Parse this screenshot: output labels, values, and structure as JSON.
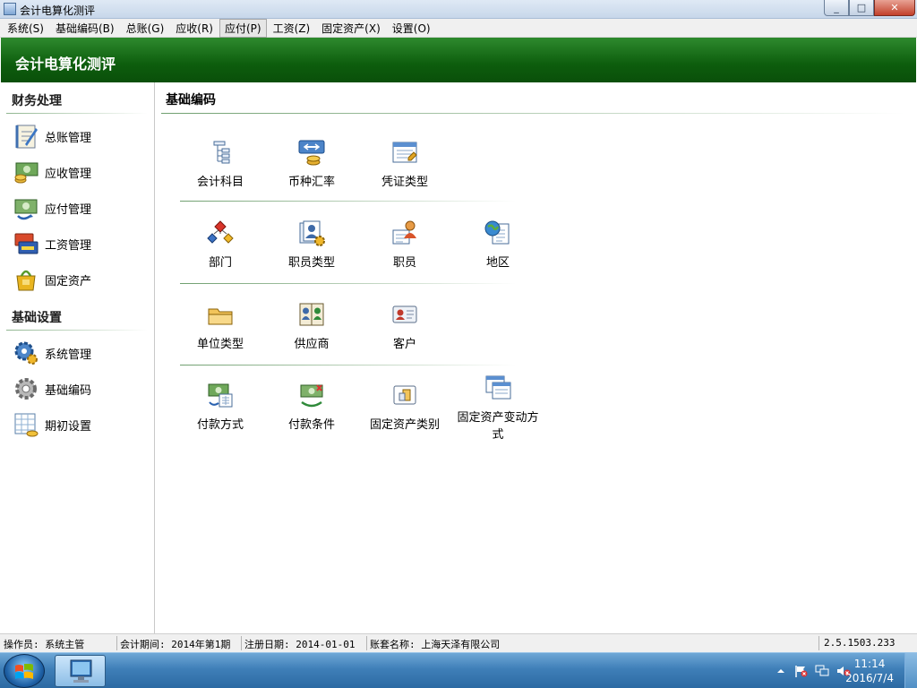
{
  "window": {
    "title": "会计电算化测评",
    "controls": {
      "minimize": "_",
      "maximize": "□",
      "close": "✕"
    }
  },
  "menu": {
    "items": [
      "系统(S)",
      "基础编码(B)",
      "总账(G)",
      "应收(R)",
      "应付(P)",
      "工资(Z)",
      "固定资产(X)",
      "设置(O)"
    ],
    "active": "应付(P)"
  },
  "header": {
    "title": "会计电算化测评"
  },
  "sidebar": {
    "sections": [
      {
        "title": "财务处理",
        "items": [
          {
            "label": "总账管理",
            "icon": "ledger-icon"
          },
          {
            "label": "应收管理",
            "icon": "receivables-icon"
          },
          {
            "label": "应付管理",
            "icon": "payables-icon"
          },
          {
            "label": "工资管理",
            "icon": "payroll-icon"
          },
          {
            "label": "固定资产",
            "icon": "fixed-assets-icon"
          }
        ]
      },
      {
        "title": "基础设置",
        "items": [
          {
            "label": "系统管理",
            "icon": "system-gear-icon"
          },
          {
            "label": "基础编码",
            "icon": "basic-code-gear-icon"
          },
          {
            "label": "期初设置",
            "icon": "opening-balance-icon"
          }
        ]
      }
    ]
  },
  "main": {
    "title": "基础编码",
    "rows": [
      [
        {
          "label": "会计科目",
          "icon": "account-tree-icon"
        },
        {
          "label": "币种汇率",
          "icon": "currency-rate-icon"
        },
        {
          "label": "凭证类型",
          "icon": "voucher-type-icon"
        }
      ],
      [
        {
          "label": "部门",
          "icon": "department-icon"
        },
        {
          "label": "职员类型",
          "icon": "staff-type-icon"
        },
        {
          "label": "职员",
          "icon": "staff-icon"
        },
        {
          "label": "地区",
          "icon": "region-icon"
        }
      ],
      [
        {
          "label": "单位类型",
          "icon": "unit-type-icon"
        },
        {
          "label": "供应商",
          "icon": "supplier-icon"
        },
        {
          "label": "客户",
          "icon": "customer-icon"
        }
      ],
      [
        {
          "label": "付款方式",
          "icon": "payment-method-icon"
        },
        {
          "label": "付款条件",
          "icon": "payment-terms-icon"
        },
        {
          "label": "固定资产类别",
          "icon": "asset-category-icon"
        },
        {
          "label": "固定资产变动方式",
          "icon": "asset-change-icon"
        }
      ]
    ]
  },
  "status": {
    "operator": "操作员: 系统主管",
    "period": "会计期间: 2014年第1期",
    "register_date": "注册日期: 2014-01-01",
    "account_set": "账套名称: 上海天泽有限公司",
    "version": "2.5.1503.233"
  },
  "taskbar": {
    "time": "11:14",
    "date": "2016/7/4",
    "tray_icons": [
      "tray-up-arrow-icon",
      "action-center-flag-icon",
      "network-icon",
      "volume-muted-icon"
    ]
  }
}
